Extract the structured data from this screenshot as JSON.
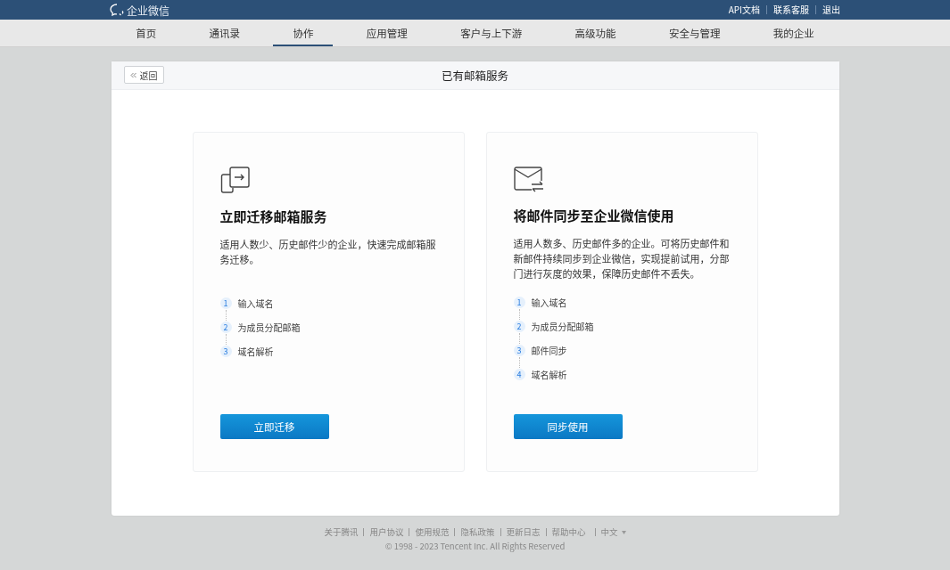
{
  "topbar": {
    "logo": "企业微信",
    "links": [
      "API文档",
      "联系客服",
      "退出"
    ]
  },
  "nav": [
    {
      "label": "首页",
      "selected": false
    },
    {
      "label": "通讯录",
      "selected": false
    },
    {
      "label": "协作",
      "selected": true
    },
    {
      "label": "应用管理",
      "selected": false
    },
    {
      "label": "客户与上下游",
      "selected": false
    },
    {
      "label": "高级功能",
      "selected": false
    },
    {
      "label": "安全与管理",
      "selected": false
    },
    {
      "label": "我的企业",
      "selected": false
    }
  ],
  "panel": {
    "back": "返回",
    "title": "已有邮箱服务"
  },
  "cards": [
    {
      "kind": "migrate",
      "title": "立即迁移邮箱服务",
      "description": "适用人数少、历史邮件少的企业，快速完成邮箱服务迁移。",
      "steps": [
        {
          "number": "1",
          "label": "输入域名"
        },
        {
          "number": "2",
          "label": "为成员分配邮箱"
        },
        {
          "number": "3",
          "label": "域名解析"
        }
      ],
      "button": "立即迁移"
    },
    {
      "kind": "sync",
      "title": "将邮件同步至企业微信使用",
      "description": "适用人数多、历史邮件多的企业。可将历史邮件和新邮件持续同步到企业微信，实现提前试用，分部门进行灰度的效果，保障历史邮件不丢失。",
      "steps": [
        {
          "number": "1",
          "label": "输入域名"
        },
        {
          "number": "2",
          "label": "为成员分配邮箱"
        },
        {
          "number": "3",
          "label": "邮件同步"
        },
        {
          "number": "4",
          "label": "域名解析"
        }
      ],
      "button": "同步使用"
    }
  ],
  "footer": {
    "links": [
      "关于腾讯",
      "用户协议",
      "使用规范",
      "隐私政策",
      "更新日志",
      "帮助中心"
    ],
    "language": "中文",
    "copyright": "© 1998 - 2023 Tencent Inc. All Rights Reserved"
  }
}
